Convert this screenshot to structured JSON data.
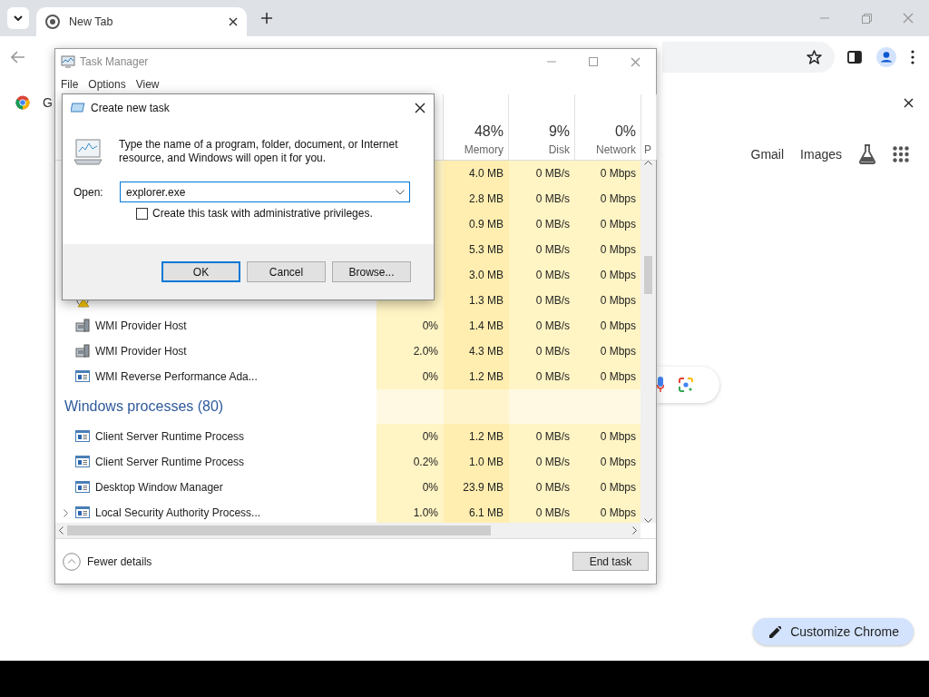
{
  "browser": {
    "tabs": [
      {
        "label": "New Tab",
        "selected": true
      }
    ],
    "infobar": {
      "text": "G"
    },
    "page_links": [
      "Gmail",
      "Images"
    ],
    "customize_button": "Customize Chrome"
  },
  "task_manager": {
    "title": "Task Manager",
    "menu": [
      "File",
      "Options",
      "View"
    ],
    "columns": [
      {
        "percent": "48%",
        "label": "Memory"
      },
      {
        "percent": "9%",
        "label": "Disk"
      },
      {
        "percent": "0%",
        "label": "Network"
      },
      {
        "label": "P"
      }
    ],
    "rows": [
      {
        "kind": "hidden",
        "expandable": false,
        "memory": "4.0 MB",
        "disk": "0 MB/s",
        "network": "0 Mbps"
      },
      {
        "kind": "hidden",
        "expandable": false,
        "memory": "2.8 MB",
        "disk": "0 MB/s",
        "network": "0 Mbps"
      },
      {
        "kind": "hidden",
        "expandable": false,
        "memory": "0.9 MB",
        "disk": "0 MB/s",
        "network": "0 Mbps"
      },
      {
        "kind": "hidden",
        "expandable": false,
        "memory": "5.3 MB",
        "disk": "0 MB/s",
        "network": "0 Mbps"
      },
      {
        "kind": "hidden",
        "expandable": false,
        "memory": "3.0 MB",
        "disk": "0 MB/s",
        "network": "0 Mbps"
      },
      {
        "kind": "notification",
        "expandable": false,
        "memory": "1.3 MB",
        "disk": "0 MB/s",
        "network": "0 Mbps"
      },
      {
        "kind": "service",
        "expandable": false,
        "name": "WMI Provider Host",
        "cpu": "0%",
        "memory": "1.4 MB",
        "disk": "0 MB/s",
        "network": "0 Mbps"
      },
      {
        "kind": "service",
        "expandable": false,
        "name": "WMI Provider Host",
        "cpu": "2.0%",
        "memory": "4.3 MB",
        "disk": "0 MB/s",
        "network": "0 Mbps"
      },
      {
        "kind": "app",
        "expandable": false,
        "name": "WMI Reverse Performance Ada...",
        "cpu": "0%",
        "memory": "1.2 MB",
        "disk": "0 MB/s",
        "network": "0 Mbps"
      },
      {
        "kind": "group",
        "name": "Windows processes (80)"
      },
      {
        "kind": "app",
        "expandable": false,
        "name": "Client Server Runtime Process",
        "cpu": "0%",
        "memory": "1.2 MB",
        "disk": "0 MB/s",
        "network": "0 Mbps"
      },
      {
        "kind": "app",
        "expandable": false,
        "name": "Client Server Runtime Process",
        "cpu": "0.2%",
        "memory": "1.0 MB",
        "disk": "0 MB/s",
        "network": "0 Mbps"
      },
      {
        "kind": "app",
        "expandable": false,
        "name": "Desktop Window Manager",
        "cpu": "0%",
        "memory": "23.9 MB",
        "disk": "0 MB/s",
        "network": "0 Mbps"
      },
      {
        "kind": "app",
        "expandable": true,
        "name": "Local Security Authority Process...",
        "cpu": "1.0%",
        "memory": "6.1 MB",
        "disk": "0 MB/s",
        "network": "0 Mbps"
      }
    ],
    "footer": {
      "details_button": "Fewer details",
      "end_task_button": "End task"
    }
  },
  "dialog": {
    "title": "Create new task",
    "message": "Type the name of a program, folder, document, or Internet resource, and Windows will open it for you.",
    "open_label": "Open:",
    "value": "explorer.exe",
    "admin_checkbox": {
      "label": "Create this task with administrative privileges.",
      "checked": false
    },
    "buttons": [
      {
        "label": "OK",
        "default": true
      },
      {
        "label": "Cancel",
        "default": false
      },
      {
        "label": "Browse...",
        "default": false
      }
    ]
  }
}
